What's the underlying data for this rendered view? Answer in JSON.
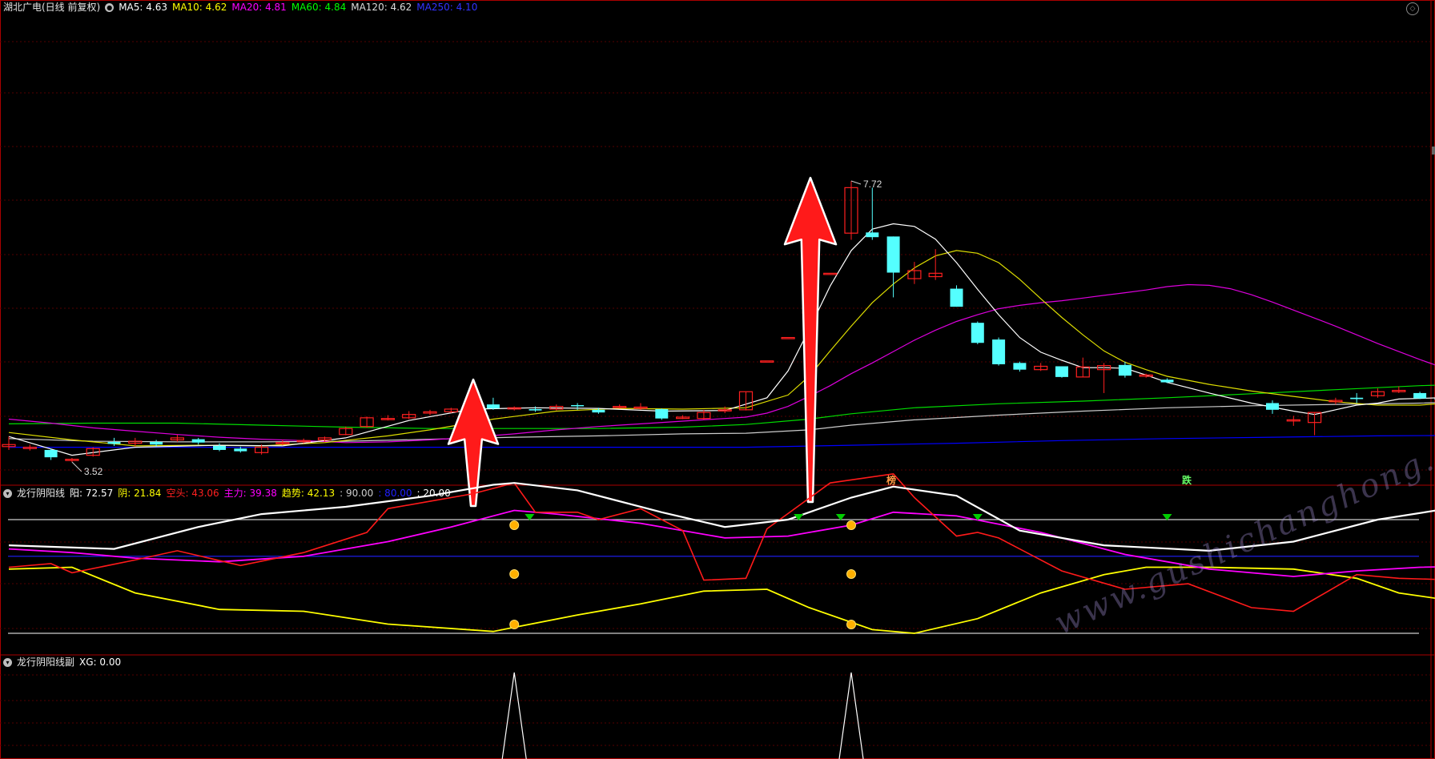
{
  "main_panel": {
    "title": "湖北广电(日线 前复权)",
    "ma": [
      {
        "label": "MA5: 4.63",
        "color": "#ffffff"
      },
      {
        "label": "MA10: 4.62",
        "color": "#ffff00"
      },
      {
        "label": "MA20: 4.81",
        "color": "#ff00ff"
      },
      {
        "label": "MA60: 4.84",
        "color": "#00ff00"
      },
      {
        "label": "MA120: 4.62",
        "color": "#dddddd"
      },
      {
        "label": "MA250: 4.10",
        "color": "#0000ff"
      }
    ],
    "high_label": "7.72",
    "low_label": "3.52",
    "markers": [
      {
        "text": "榜",
        "color": "#ff9944"
      },
      {
        "text": "跌",
        "color": "#66ff66"
      }
    ]
  },
  "sub_panel": {
    "title": "龙行阴阳线",
    "labels": [
      {
        "text": "阳: 72.57",
        "color": "#ffffff"
      },
      {
        "text": "阴: 21.84",
        "color": "#ffff00"
      },
      {
        "text": "空头: 43.06",
        "color": "#ff2020"
      },
      {
        "text": "主力: 39.38",
        "color": "#ff00ff"
      },
      {
        "text": "趋势: 42.13",
        "color": "#ffff00"
      },
      {
        "text": ": 90.00",
        "color": "#cccccc"
      },
      {
        "text": ": 80.00",
        "color": "#2020ff"
      },
      {
        "text": ": 20.00",
        "color": "#ffffff"
      }
    ]
  },
  "sub_panel2": {
    "title": "龙行阴阳线副",
    "labels": [
      {
        "text": "XG: 0.00",
        "color": "#ffffff"
      }
    ]
  },
  "watermark": "www.gushichanghong.com",
  "colors": {
    "up": "#ff2020",
    "down": "#54ffff",
    "grid": "#550000",
    "border": "#aa0000"
  },
  "chart_data": {
    "type": "candlestick",
    "candles": [
      [
        3.75,
        3.78,
        3.9,
        3.7
      ],
      [
        3.72,
        3.74,
        3.78,
        3.69
      ],
      [
        3.7,
        3.59,
        3.72,
        3.55
      ],
      [
        3.55,
        3.56,
        3.58,
        3.52
      ],
      [
        3.62,
        3.72,
        3.74,
        3.6
      ],
      [
        3.82,
        3.79,
        3.88,
        3.76
      ],
      [
        3.8,
        3.83,
        3.88,
        3.75
      ],
      [
        3.82,
        3.78,
        3.85,
        3.75
      ],
      [
        3.85,
        3.88,
        3.93,
        3.82
      ],
      [
        3.86,
        3.81,
        3.88,
        3.78
      ],
      [
        3.76,
        3.7,
        3.8,
        3.68
      ],
      [
        3.72,
        3.68,
        3.75,
        3.66
      ],
      [
        3.66,
        3.74,
        3.78,
        3.63
      ],
      [
        3.8,
        3.81,
        3.85,
        3.77
      ],
      [
        3.83,
        3.84,
        3.87,
        3.8
      ],
      [
        3.85,
        3.88,
        3.9,
        3.82
      ],
      [
        3.93,
        4.02,
        4.05,
        3.92
      ],
      [
        4.05,
        4.18,
        4.2,
        4.03
      ],
      [
        4.17,
        4.17,
        4.22,
        4.14
      ],
      [
        4.18,
        4.23,
        4.28,
        4.16
      ],
      [
        4.25,
        4.27,
        4.3,
        4.22
      ],
      [
        4.27,
        4.31,
        4.33,
        4.25
      ],
      [
        4.3,
        4.41,
        4.58,
        4.3
      ],
      [
        4.38,
        4.32,
        4.48,
        4.3
      ],
      [
        4.32,
        4.33,
        4.35,
        4.29
      ],
      [
        4.31,
        4.29,
        4.35,
        4.27
      ],
      [
        4.31,
        4.35,
        4.38,
        4.29
      ],
      [
        4.37,
        4.36,
        4.4,
        4.3
      ],
      [
        4.3,
        4.26,
        4.33,
        4.24
      ],
      [
        4.35,
        4.35,
        4.38,
        4.32
      ],
      [
        4.33,
        4.34,
        4.4,
        4.3
      ],
      [
        4.31,
        4.17,
        4.32,
        4.15
      ],
      [
        4.17,
        4.19,
        4.22,
        4.16
      ],
      [
        4.17,
        4.26,
        4.3,
        4.15
      ],
      [
        4.29,
        4.3,
        4.35,
        4.25
      ],
      [
        4.3,
        4.57,
        4.57,
        4.29
      ],
      [
        5.03,
        5.03,
        5.03,
        5.03
      ],
      [
        5.38,
        5.38,
        5.38,
        5.38
      ],
      [
        5.76,
        5.76,
        5.76,
        5.76
      ],
      [
        6.34,
        6.34,
        6.34,
        6.34
      ],
      [
        6.94,
        7.62,
        7.72,
        6.84
      ],
      [
        6.95,
        6.88,
        7.62,
        6.84
      ],
      [
        6.89,
        6.35,
        6.89,
        5.98
      ],
      [
        6.26,
        6.38,
        6.51,
        6.18
      ],
      [
        6.29,
        6.34,
        6.7,
        6.24
      ],
      [
        6.11,
        5.84,
        6.16,
        5.84
      ],
      [
        5.6,
        5.3,
        5.62,
        5.28
      ],
      [
        5.35,
        4.98,
        5.38,
        4.96
      ],
      [
        5.0,
        4.9,
        5.02,
        4.87
      ],
      [
        4.9,
        4.95,
        5.0,
        4.88
      ],
      [
        4.95,
        4.79,
        4.95,
        4.78
      ],
      [
        4.79,
        4.94,
        5.08,
        4.79
      ],
      [
        4.9,
        4.96,
        5.0,
        4.55
      ],
      [
        4.97,
        4.81,
        5.02,
        4.78
      ],
      [
        4.8,
        4.82,
        4.84,
        4.78
      ],
      [
        4.75,
        4.71,
        4.77,
        4.7
      ],
      null,
      null,
      null,
      null,
      [
        4.4,
        4.3,
        4.44,
        4.24
      ],
      [
        4.14,
        4.15,
        4.21,
        4.06
      ],
      [
        4.11,
        4.26,
        4.26,
        3.92
      ],
      [
        4.42,
        4.44,
        4.48,
        4.38
      ],
      [
        4.48,
        4.46,
        4.55,
        4.4
      ],
      [
        4.51,
        4.57,
        4.62,
        4.48
      ],
      [
        4.57,
        4.59,
        4.65,
        4.55
      ],
      [
        4.55,
        4.47,
        4.57,
        4.46
      ],
      [
        4.47,
        4.45,
        4.53,
        4.43
      ],
      [
        4.49,
        4.48,
        4.51,
        4.46
      ],
      [
        4.48,
        4.53,
        4.57,
        4.45
      ],
      [
        4.56,
        4.51,
        4.57,
        4.49
      ],
      [
        4.54,
        4.57,
        4.59,
        4.53
      ]
    ],
    "ma5": [
      [
        0,
        3.9
      ],
      [
        3,
        3.62
      ],
      [
        6,
        3.74
      ],
      [
        10,
        3.77
      ],
      [
        13,
        3.76
      ],
      [
        16,
        3.88
      ],
      [
        19,
        4.14
      ],
      [
        22,
        4.31
      ],
      [
        25,
        4.33
      ],
      [
        28,
        4.32
      ],
      [
        31,
        4.28
      ],
      [
        34,
        4.29
      ],
      [
        36,
        4.48
      ],
      [
        37,
        4.88
      ],
      [
        38,
        5.5
      ],
      [
        39,
        6.15
      ],
      [
        40,
        6.68
      ],
      [
        41,
        7.0
      ],
      [
        42,
        7.08
      ],
      [
        43,
        7.04
      ],
      [
        44,
        6.85
      ],
      [
        45,
        6.5
      ],
      [
        46,
        6.1
      ],
      [
        47,
        5.72
      ],
      [
        48,
        5.38
      ],
      [
        49,
        5.16
      ],
      [
        50,
        5.04
      ],
      [
        51,
        4.93
      ],
      [
        52,
        4.93
      ],
      [
        53,
        4.92
      ],
      [
        54,
        4.82
      ],
      [
        55,
        4.71
      ],
      [
        57,
        4.55
      ],
      [
        59,
        4.4
      ],
      [
        60,
        4.34
      ],
      [
        61,
        4.28
      ],
      [
        62,
        4.23
      ],
      [
        63,
        4.3
      ],
      [
        64,
        4.37
      ],
      [
        65,
        4.4
      ],
      [
        66,
        4.46
      ],
      [
        68,
        4.48
      ],
      [
        69,
        4.49
      ],
      [
        70,
        4.48
      ],
      [
        71,
        4.49
      ],
      [
        72,
        4.52
      ]
    ],
    "ma10": [
      [
        0,
        3.96
      ],
      [
        3,
        3.85
      ],
      [
        6,
        3.76
      ],
      [
        9,
        3.77
      ],
      [
        12,
        3.76
      ],
      [
        15,
        3.81
      ],
      [
        18,
        3.91
      ],
      [
        20,
        4.0
      ],
      [
        23,
        4.16
      ],
      [
        26,
        4.28
      ],
      [
        29,
        4.32
      ],
      [
        32,
        4.31
      ],
      [
        35,
        4.33
      ],
      [
        37,
        4.52
      ],
      [
        38,
        4.8
      ],
      [
        39,
        5.18
      ],
      [
        40,
        5.55
      ],
      [
        41,
        5.9
      ],
      [
        42,
        6.18
      ],
      [
        43,
        6.42
      ],
      [
        44,
        6.6
      ],
      [
        45,
        6.68
      ],
      [
        46,
        6.64
      ],
      [
        47,
        6.5
      ],
      [
        48,
        6.25
      ],
      [
        49,
        5.96
      ],
      [
        50,
        5.68
      ],
      [
        51,
        5.42
      ],
      [
        52,
        5.18
      ],
      [
        53,
        5.01
      ],
      [
        54,
        4.9
      ],
      [
        55,
        4.8
      ],
      [
        57,
        4.68
      ],
      [
        59,
        4.58
      ],
      [
        61,
        4.5
      ],
      [
        63,
        4.42
      ],
      [
        65,
        4.37
      ],
      [
        67,
        4.37
      ],
      [
        69,
        4.42
      ],
      [
        71,
        4.49
      ],
      [
        72,
        4.52
      ]
    ],
    "ma20": [
      [
        0,
        4.16
      ],
      [
        2,
        4.1
      ],
      [
        4,
        4.03
      ],
      [
        6,
        3.98
      ],
      [
        8,
        3.93
      ],
      [
        10,
        3.89
      ],
      [
        12,
        3.86
      ],
      [
        14,
        3.84
      ],
      [
        16,
        3.81
      ],
      [
        18,
        3.82
      ],
      [
        20,
        3.85
      ],
      [
        22,
        3.89
      ],
      [
        24,
        3.94
      ],
      [
        26,
        4.0
      ],
      [
        28,
        4.05
      ],
      [
        30,
        4.09
      ],
      [
        32,
        4.13
      ],
      [
        34,
        4.17
      ],
      [
        35,
        4.19
      ],
      [
        36,
        4.25
      ],
      [
        37,
        4.35
      ],
      [
        38,
        4.5
      ],
      [
        39,
        4.66
      ],
      [
        40,
        4.84
      ],
      [
        41,
        5.0
      ],
      [
        42,
        5.17
      ],
      [
        43,
        5.34
      ],
      [
        44,
        5.49
      ],
      [
        45,
        5.62
      ],
      [
        46,
        5.72
      ],
      [
        47,
        5.81
      ],
      [
        48,
        5.86
      ],
      [
        49,
        5.9
      ],
      [
        50,
        5.93
      ],
      [
        51,
        5.97
      ],
      [
        52,
        6.01
      ],
      [
        53,
        6.05
      ],
      [
        54,
        6.09
      ],
      [
        55,
        6.14
      ],
      [
        56,
        6.17
      ],
      [
        57,
        6.16
      ],
      [
        58,
        6.11
      ],
      [
        59,
        6.02
      ],
      [
        60,
        5.91
      ],
      [
        61,
        5.79
      ],
      [
        62,
        5.67
      ],
      [
        63,
        5.55
      ],
      [
        64,
        5.42
      ],
      [
        65,
        5.29
      ],
      [
        66,
        5.17
      ],
      [
        67,
        5.05
      ],
      [
        68,
        4.94
      ],
      [
        69,
        4.85
      ],
      [
        70,
        4.8
      ],
      [
        71,
        4.78
      ],
      [
        72,
        4.75
      ]
    ],
    "ma60": [
      [
        0,
        4.09
      ],
      [
        4,
        4.1
      ],
      [
        8,
        4.1
      ],
      [
        12,
        4.07
      ],
      [
        16,
        4.04
      ],
      [
        20,
        4.02
      ],
      [
        24,
        4.02
      ],
      [
        28,
        4.02
      ],
      [
        32,
        4.04
      ],
      [
        35,
        4.08
      ],
      [
        38,
        4.16
      ],
      [
        40,
        4.24
      ],
      [
        43,
        4.33
      ],
      [
        47,
        4.39
      ],
      [
        51,
        4.43
      ],
      [
        55,
        4.48
      ],
      [
        59,
        4.54
      ],
      [
        63,
        4.6
      ],
      [
        67,
        4.66
      ],
      [
        70,
        4.69
      ],
      [
        72,
        4.71
      ]
    ],
    "ma120": [
      [
        0,
        3.87
      ],
      [
        4,
        3.83
      ],
      [
        8,
        3.82
      ],
      [
        12,
        3.82
      ],
      [
        16,
        3.83
      ],
      [
        20,
        3.86
      ],
      [
        24,
        3.89
      ],
      [
        28,
        3.91
      ],
      [
        32,
        3.94
      ],
      [
        35,
        3.95
      ],
      [
        38,
        4.0
      ],
      [
        40,
        4.07
      ],
      [
        43,
        4.15
      ],
      [
        47,
        4.22
      ],
      [
        51,
        4.28
      ],
      [
        55,
        4.33
      ],
      [
        59,
        4.36
      ],
      [
        63,
        4.38
      ],
      [
        67,
        4.4
      ],
      [
        70,
        4.43
      ],
      [
        72,
        4.44
      ]
    ],
    "ma250": [
      [
        0,
        3.74
      ],
      [
        10,
        3.74
      ],
      [
        20,
        3.74
      ],
      [
        30,
        3.74
      ],
      [
        35,
        3.74
      ],
      [
        40,
        3.77
      ],
      [
        45,
        3.8
      ],
      [
        50,
        3.84
      ],
      [
        55,
        3.87
      ],
      [
        60,
        3.89
      ],
      [
        65,
        3.91
      ],
      [
        70,
        3.92
      ],
      [
        72,
        3.92
      ]
    ],
    "yang": [
      [
        0,
        83.0
      ],
      [
        5,
        82.0
      ],
      [
        9,
        88.0
      ],
      [
        12,
        91.5
      ],
      [
        16,
        93.5
      ],
      [
        20,
        96.5
      ],
      [
        23,
        99.5
      ],
      [
        24,
        100.0
      ],
      [
        27,
        98.0
      ],
      [
        31,
        92.0
      ],
      [
        34,
        88.0
      ],
      [
        37,
        90.0
      ],
      [
        40,
        96.0
      ],
      [
        42,
        99.0
      ],
      [
        45,
        96.5
      ],
      [
        48,
        87.0
      ],
      [
        52,
        83.0
      ],
      [
        57,
        81.5
      ],
      [
        61,
        84.0
      ],
      [
        65,
        90.0
      ],
      [
        70,
        94.5
      ],
      [
        71,
        95.5
      ]
    ],
    "yin": [
      [
        0,
        76.5
      ],
      [
        3,
        77.0
      ],
      [
        6,
        70.0
      ],
      [
        10,
        65.5
      ],
      [
        14,
        65.0
      ],
      [
        18,
        61.5
      ],
      [
        23,
        59.5
      ],
      [
        27,
        64.0
      ],
      [
        30,
        67.0
      ],
      [
        33,
        70.5
      ],
      [
        36,
        71.0
      ],
      [
        38,
        66.0
      ],
      [
        41,
        60.0
      ],
      [
        43,
        59.0
      ],
      [
        46,
        63.0
      ],
      [
        49,
        70.0
      ],
      [
        52,
        75.0
      ],
      [
        54,
        77.0
      ],
      [
        57,
        77.0
      ],
      [
        61,
        76.5
      ],
      [
        64,
        74.0
      ],
      [
        66,
        70.0
      ],
      [
        69,
        67.5
      ],
      [
        71,
        67.5
      ]
    ],
    "kongtou": [
      [
        0,
        77.0
      ],
      [
        2,
        78.0
      ],
      [
        3,
        75.5
      ],
      [
        6,
        79.0
      ],
      [
        8,
        81.5
      ],
      [
        11,
        77.5
      ],
      [
        14,
        81.0
      ],
      [
        17,
        86.5
      ],
      [
        18,
        93.0
      ],
      [
        20,
        95.0
      ],
      [
        22,
        97.0
      ],
      [
        24,
        100.0
      ],
      [
        25,
        92.0
      ],
      [
        27,
        92.0
      ],
      [
        28,
        90.0
      ],
      [
        30,
        93.0
      ],
      [
        31,
        90.0
      ],
      [
        32,
        87.0
      ],
      [
        33,
        73.5
      ],
      [
        35,
        74.0
      ],
      [
        36,
        87.5
      ],
      [
        39,
        100.0
      ],
      [
        42,
        102.5
      ],
      [
        43,
        96.0
      ],
      [
        45,
        85.5
      ],
      [
        46,
        86.5
      ],
      [
        47,
        85.0
      ],
      [
        50,
        76.0
      ],
      [
        53,
        71.0
      ],
      [
        56,
        72.5
      ],
      [
        59,
        66.0
      ],
      [
        61,
        65.0
      ],
      [
        64,
        75.0
      ],
      [
        66,
        74.0
      ],
      [
        69,
        73.5
      ],
      [
        71,
        76.0
      ]
    ],
    "zhuli": [
      [
        0,
        82.0
      ],
      [
        3,
        81.0
      ],
      [
        6,
        79.5
      ],
      [
        10,
        78.5
      ],
      [
        14,
        80.0
      ],
      [
        18,
        84.0
      ],
      [
        21,
        88.0
      ],
      [
        24,
        92.5
      ],
      [
        26,
        91.5
      ],
      [
        30,
        89.0
      ],
      [
        34,
        85.0
      ],
      [
        37,
        85.5
      ],
      [
        40,
        88.5
      ],
      [
        42,
        92.0
      ],
      [
        45,
        91.0
      ],
      [
        49,
        86.5
      ],
      [
        53,
        80.5
      ],
      [
        57,
        76.5
      ],
      [
        61,
        74.5
      ],
      [
        64,
        76.0
      ],
      [
        67,
        77.0
      ],
      [
        71,
        77.5
      ]
    ],
    "xg_spikes": [
      24,
      40
    ]
  }
}
